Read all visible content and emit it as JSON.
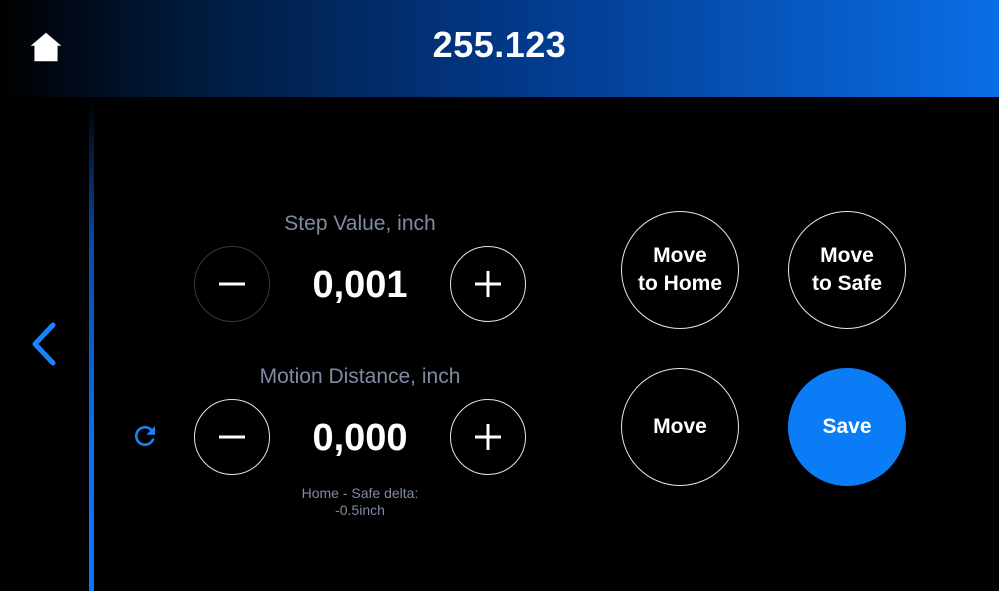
{
  "header": {
    "title": "255.123",
    "gradient_end_color": "#0a6ee6"
  },
  "icons": {
    "home": "home-icon",
    "back": "chevron-left-icon",
    "reset": "refresh-icon",
    "minus": "minus-icon",
    "plus": "plus-icon"
  },
  "step": {
    "label": "Step Value, inch",
    "value": "0,001"
  },
  "motion": {
    "label": "Motion Distance, inch",
    "value": "0,000"
  },
  "delta_note": {
    "line1": "Home - Safe delta:",
    "line2": "-0.5inch"
  },
  "actions": {
    "move_home_line1": "Move",
    "move_home_line2": "to Home",
    "move_safe_line1": "Move",
    "move_safe_line2": "to Safe",
    "move": "Move",
    "save": "Save"
  },
  "colors": {
    "accent": "#0a7cf6",
    "label": "#7f8aa3",
    "background": "#000000"
  }
}
